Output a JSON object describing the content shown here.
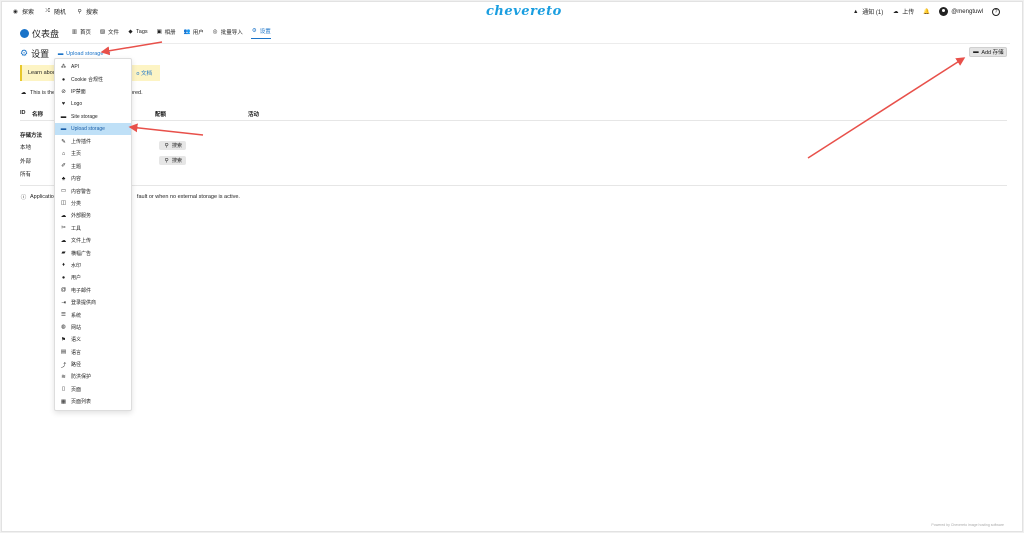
{
  "topbar": {
    "explore": "探索",
    "random": "随机",
    "search": "搜索",
    "logo": "chevereto",
    "notifications": "通知 (1)",
    "upload": "上传",
    "username": "@mengtuwl",
    "help": "?"
  },
  "dashboard": {
    "title": "仪表盘",
    "nav": [
      {
        "label": "首页",
        "icon": "bar-chart-icon"
      },
      {
        "label": "文件",
        "icon": "images-icon"
      },
      {
        "label": "Tags",
        "icon": "tags-icon"
      },
      {
        "label": "相册",
        "icon": "album-icon"
      },
      {
        "label": "用户",
        "icon": "users-icon"
      },
      {
        "label": "批量导入",
        "icon": "database-icon"
      },
      {
        "label": "设置",
        "icon": "gear-icon"
      }
    ]
  },
  "settings": {
    "title": "设置",
    "breadcrumb": "Upload storage",
    "add_button": "Add 存储"
  },
  "notice": {
    "text": "Learn abou",
    "doc_link": "o 文档"
  },
  "info_line": {
    "text_start": "This is the",
    "text_end": "ored."
  },
  "table": {
    "headers": [
      "ID",
      "名称",
      "配额",
      "活动"
    ]
  },
  "storage_section": {
    "title": "存储方法",
    "rows": [
      {
        "label": "本地",
        "button": "搜索"
      },
      {
        "label": "外部",
        "button": "搜索"
      },
      {
        "label": "所有",
        "button": ""
      }
    ]
  },
  "footer_note": {
    "text_start": "Application",
    "text_end": "fault or when no external storage is active."
  },
  "powered_by": "Powered by Chevereto image hosting software",
  "menu": {
    "active_index": 5,
    "items": [
      {
        "label": "API",
        "icon": "api-icon"
      },
      {
        "label": "Cookie 合规性",
        "icon": "cookie-icon"
      },
      {
        "label": "IP禁面",
        "icon": "ban-icon"
      },
      {
        "label": "Logo",
        "icon": "heart-icon"
      },
      {
        "label": "Site storage",
        "icon": "hdd-icon"
      },
      {
        "label": "Upload storage",
        "icon": "hdd-upload-icon"
      },
      {
        "label": "上传插件",
        "icon": "plugin-icon"
      },
      {
        "label": "主页",
        "icon": "home-icon"
      },
      {
        "label": "主题",
        "icon": "brush-icon"
      },
      {
        "label": "内容",
        "icon": "shapes-icon"
      },
      {
        "label": "内容警告",
        "icon": "monitor-icon"
      },
      {
        "label": "分类",
        "icon": "columns-icon"
      },
      {
        "label": "外部服务",
        "icon": "cloud-icon"
      },
      {
        "label": "工具",
        "icon": "tools-icon"
      },
      {
        "label": "文件上传",
        "icon": "cloud-upload-icon"
      },
      {
        "label": "横幅广告",
        "icon": "ad-icon"
      },
      {
        "label": "水印",
        "icon": "drop-icon"
      },
      {
        "label": "用户",
        "icon": "user-icon"
      },
      {
        "label": "电子邮件",
        "icon": "at-icon"
      },
      {
        "label": "登录提供商",
        "icon": "login-icon"
      },
      {
        "label": "系统",
        "icon": "server-icon"
      },
      {
        "label": "网站",
        "icon": "globe-icon"
      },
      {
        "label": "语义",
        "icon": "flag-icon"
      },
      {
        "label": "语言",
        "icon": "language-icon"
      },
      {
        "label": "路径",
        "icon": "route-icon"
      },
      {
        "label": "防洪保护",
        "icon": "flood-icon"
      },
      {
        "label": "页面",
        "icon": "file-icon"
      },
      {
        "label": "页面列表",
        "icon": "list-icon"
      }
    ]
  },
  "colors": {
    "accent": "#1a73c8",
    "logo": "#1a9ee0",
    "highlight": "#bfe0f7",
    "notice_bg": "#fdf4c4",
    "arrow": "#e8504a"
  }
}
